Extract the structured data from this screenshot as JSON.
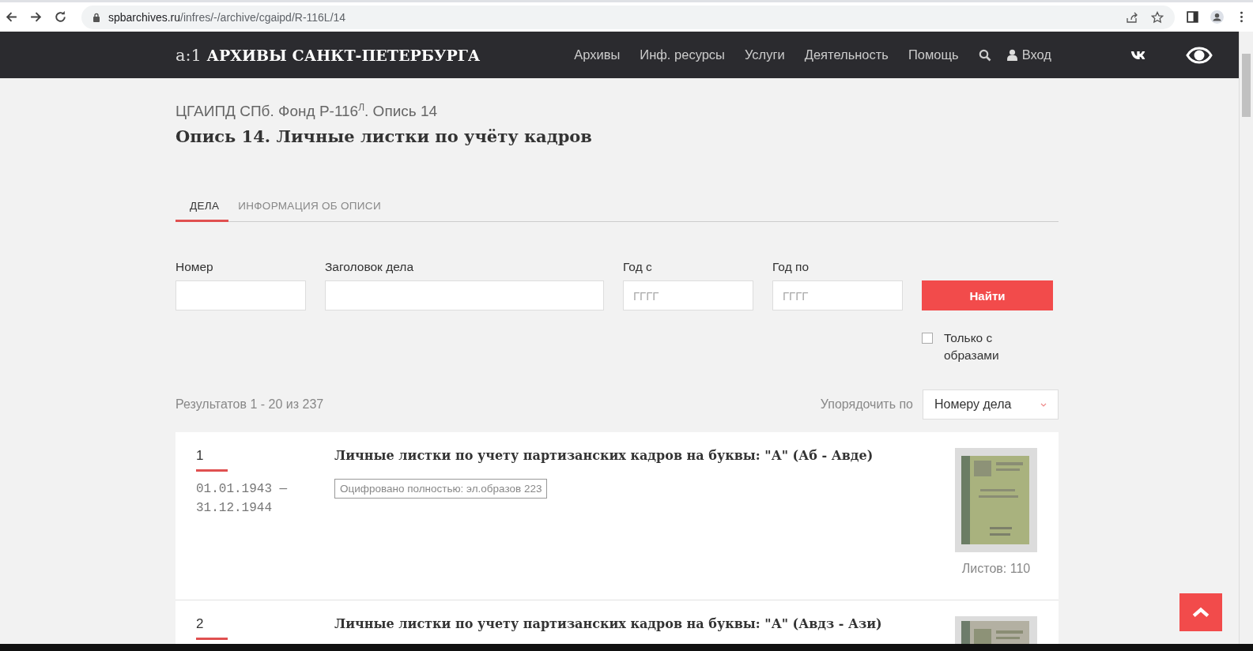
{
  "browser": {
    "url_host": "spbarchives.ru",
    "url_path": "/infres/-/archive/cgaipd/R-116L/14"
  },
  "header": {
    "logo_mark": "a:1",
    "logo_text": "АРХИВЫ САНКТ-ПЕТЕРБУРГА",
    "nav": [
      "Архивы",
      "Инф. ресурсы",
      "Услуги",
      "Деятельность",
      "Помощь"
    ],
    "login": "Вход"
  },
  "breadcrumb": "ЦГАИПД СПб. Фонд Р-116$^{Л}$. Опись 14",
  "title": "Опись 14. Личные листки по учёту кадров",
  "tabs": [
    {
      "label": "ДЕЛА",
      "selected": true
    },
    {
      "label": "ИНФОРМАЦИЯ ОБ ОПИСИ",
      "selected": false
    }
  ],
  "filters": [
    {
      "label": "Номер"
    },
    {
      "label": "Заголовок дела"
    },
    {
      "label": "Год с",
      "placeholder": "ГГГГ"
    },
    {
      "label": "Год по",
      "placeholder": "ГГГГ"
    }
  ],
  "search_button": "Найти",
  "only_with_images": {
    "label": "Только с образами",
    "checked": false
  },
  "results": "Результатов 1 - 20 из 237",
  "sort": {
    "label": "Упорядочить по",
    "value": "Номеру дела"
  },
  "records": [
    {
      "number": "1",
      "dates": "01.01.1943 —\n31.12.1944",
      "title": "Личные листки по учету партизанских кадров на буквы: \"А\" (Аб - Авде)",
      "badge": "Оцифровано полностью: эл.образов 223",
      "sheets": "Листов: 110"
    },
    {
      "number": "2",
      "title": "Личные листки по учету партизанских кадров на буквы: \"А\" (Авдз - Ази)"
    }
  ]
}
